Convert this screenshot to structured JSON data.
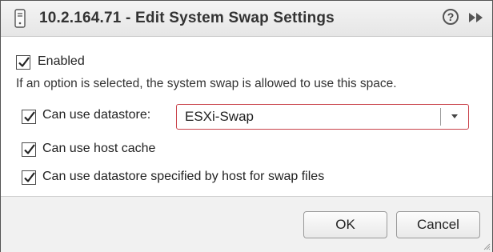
{
  "title": "10.2.164.71 - Edit System Swap Settings",
  "help_glyph": "?",
  "enabled_label": "Enabled",
  "info_text": "If an option is selected, the system swap is allowed to use this space.",
  "options": {
    "datastore_label": "Can use datastore:",
    "datastore_value": "ESXi-Swap",
    "host_cache_label": "Can use host cache",
    "host_specified_label": "Can use datastore specified by host for swap files"
  },
  "buttons": {
    "ok": "OK",
    "cancel": "Cancel"
  },
  "checked": {
    "enabled": true,
    "datastore": true,
    "host_cache": true,
    "host_specified": true
  },
  "colors": {
    "select_border": "#c9424a",
    "titlebar": "#ececec",
    "footer": "#f1f1f1"
  }
}
